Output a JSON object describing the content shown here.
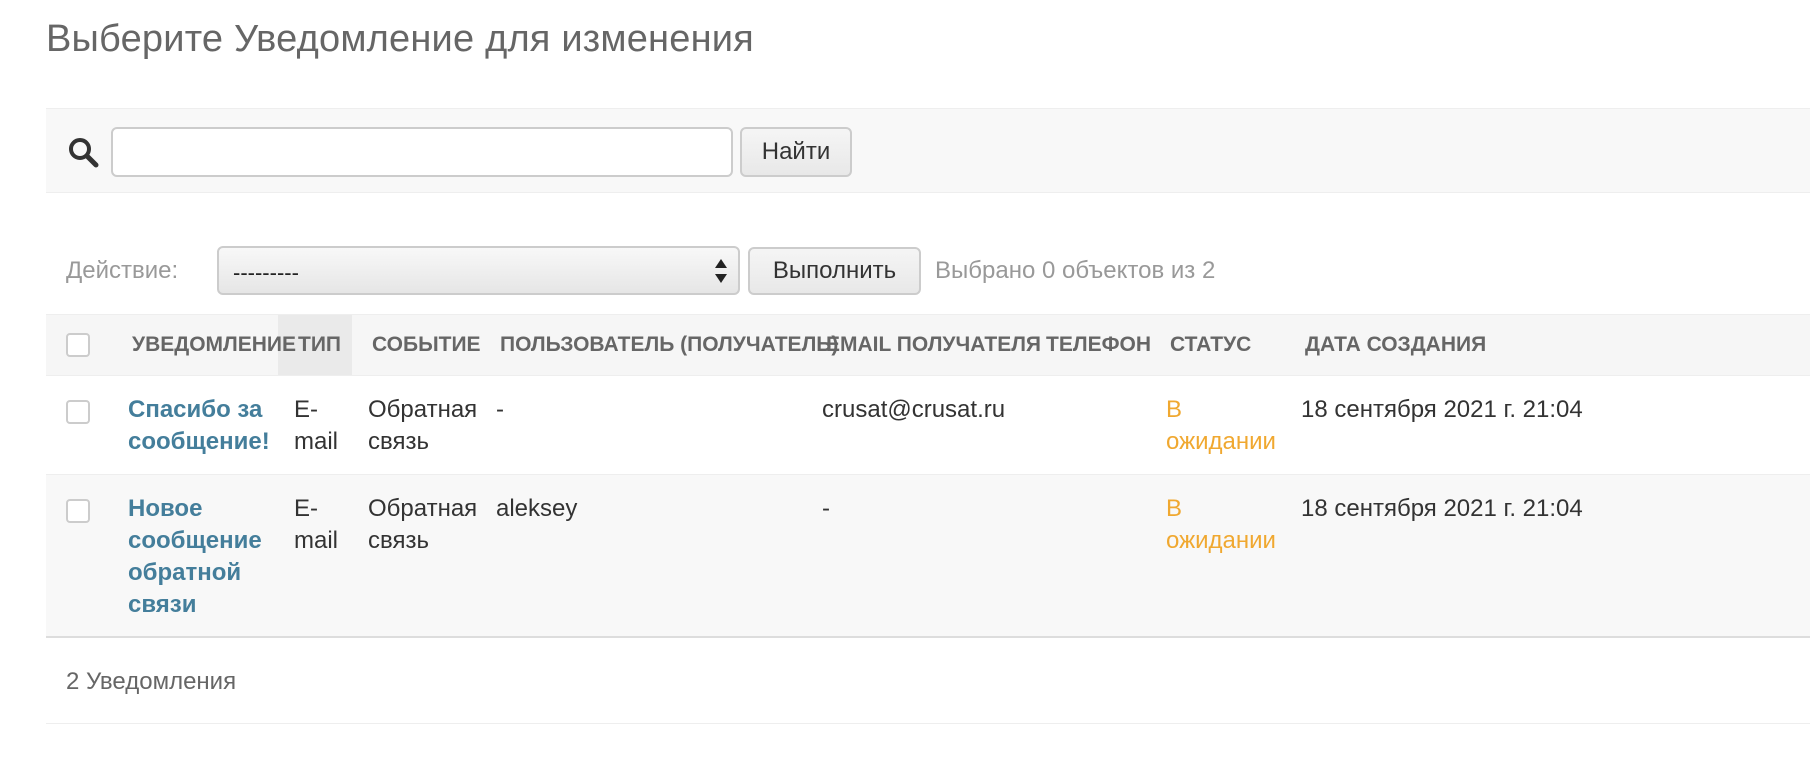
{
  "page": {
    "title": "Выберите Уведомление для изменения"
  },
  "search": {
    "value": "",
    "placeholder": "",
    "button_label": "Найти",
    "icon": "search-icon"
  },
  "actions": {
    "label": "Действие:",
    "selected_option": "---------",
    "run_label": "Выполнить",
    "counter_text": "Выбрано 0 объектов из 2"
  },
  "table": {
    "columns": [
      "Уведомление",
      "Тип",
      "Событие",
      "Пользователь (получатель)",
      "Email получателя",
      "Телефон",
      "Статус",
      "Дата создания"
    ],
    "rows": [
      {
        "notification_lines": [
          "Спасибо за",
          "сообщение!"
        ],
        "type_lines": [
          "E-",
          "mail"
        ],
        "event_lines": [
          "Обратная",
          "связь"
        ],
        "user": "-",
        "email": "crusat@crusat.ru",
        "phone": "",
        "status_lines": [
          "В",
          "ожидании"
        ],
        "created": "18 сентября 2021 г. 21:04"
      },
      {
        "notification_lines": [
          "Новое",
          "сообщение",
          "обратной",
          "связи"
        ],
        "type_lines": [
          "E-",
          "mail"
        ],
        "event_lines": [
          "Обратная",
          "связь"
        ],
        "user": "aleksey",
        "email": "-",
        "phone": "",
        "status_lines": [
          "В",
          "ожидании"
        ],
        "created": "18 сентября 2021 г. 21:04"
      }
    ]
  },
  "paginator": {
    "text": "2 Уведомления"
  },
  "colors": {
    "link": "#447e9b",
    "status_pending": "#f0a830",
    "header_bg": "#f6f6f6"
  }
}
